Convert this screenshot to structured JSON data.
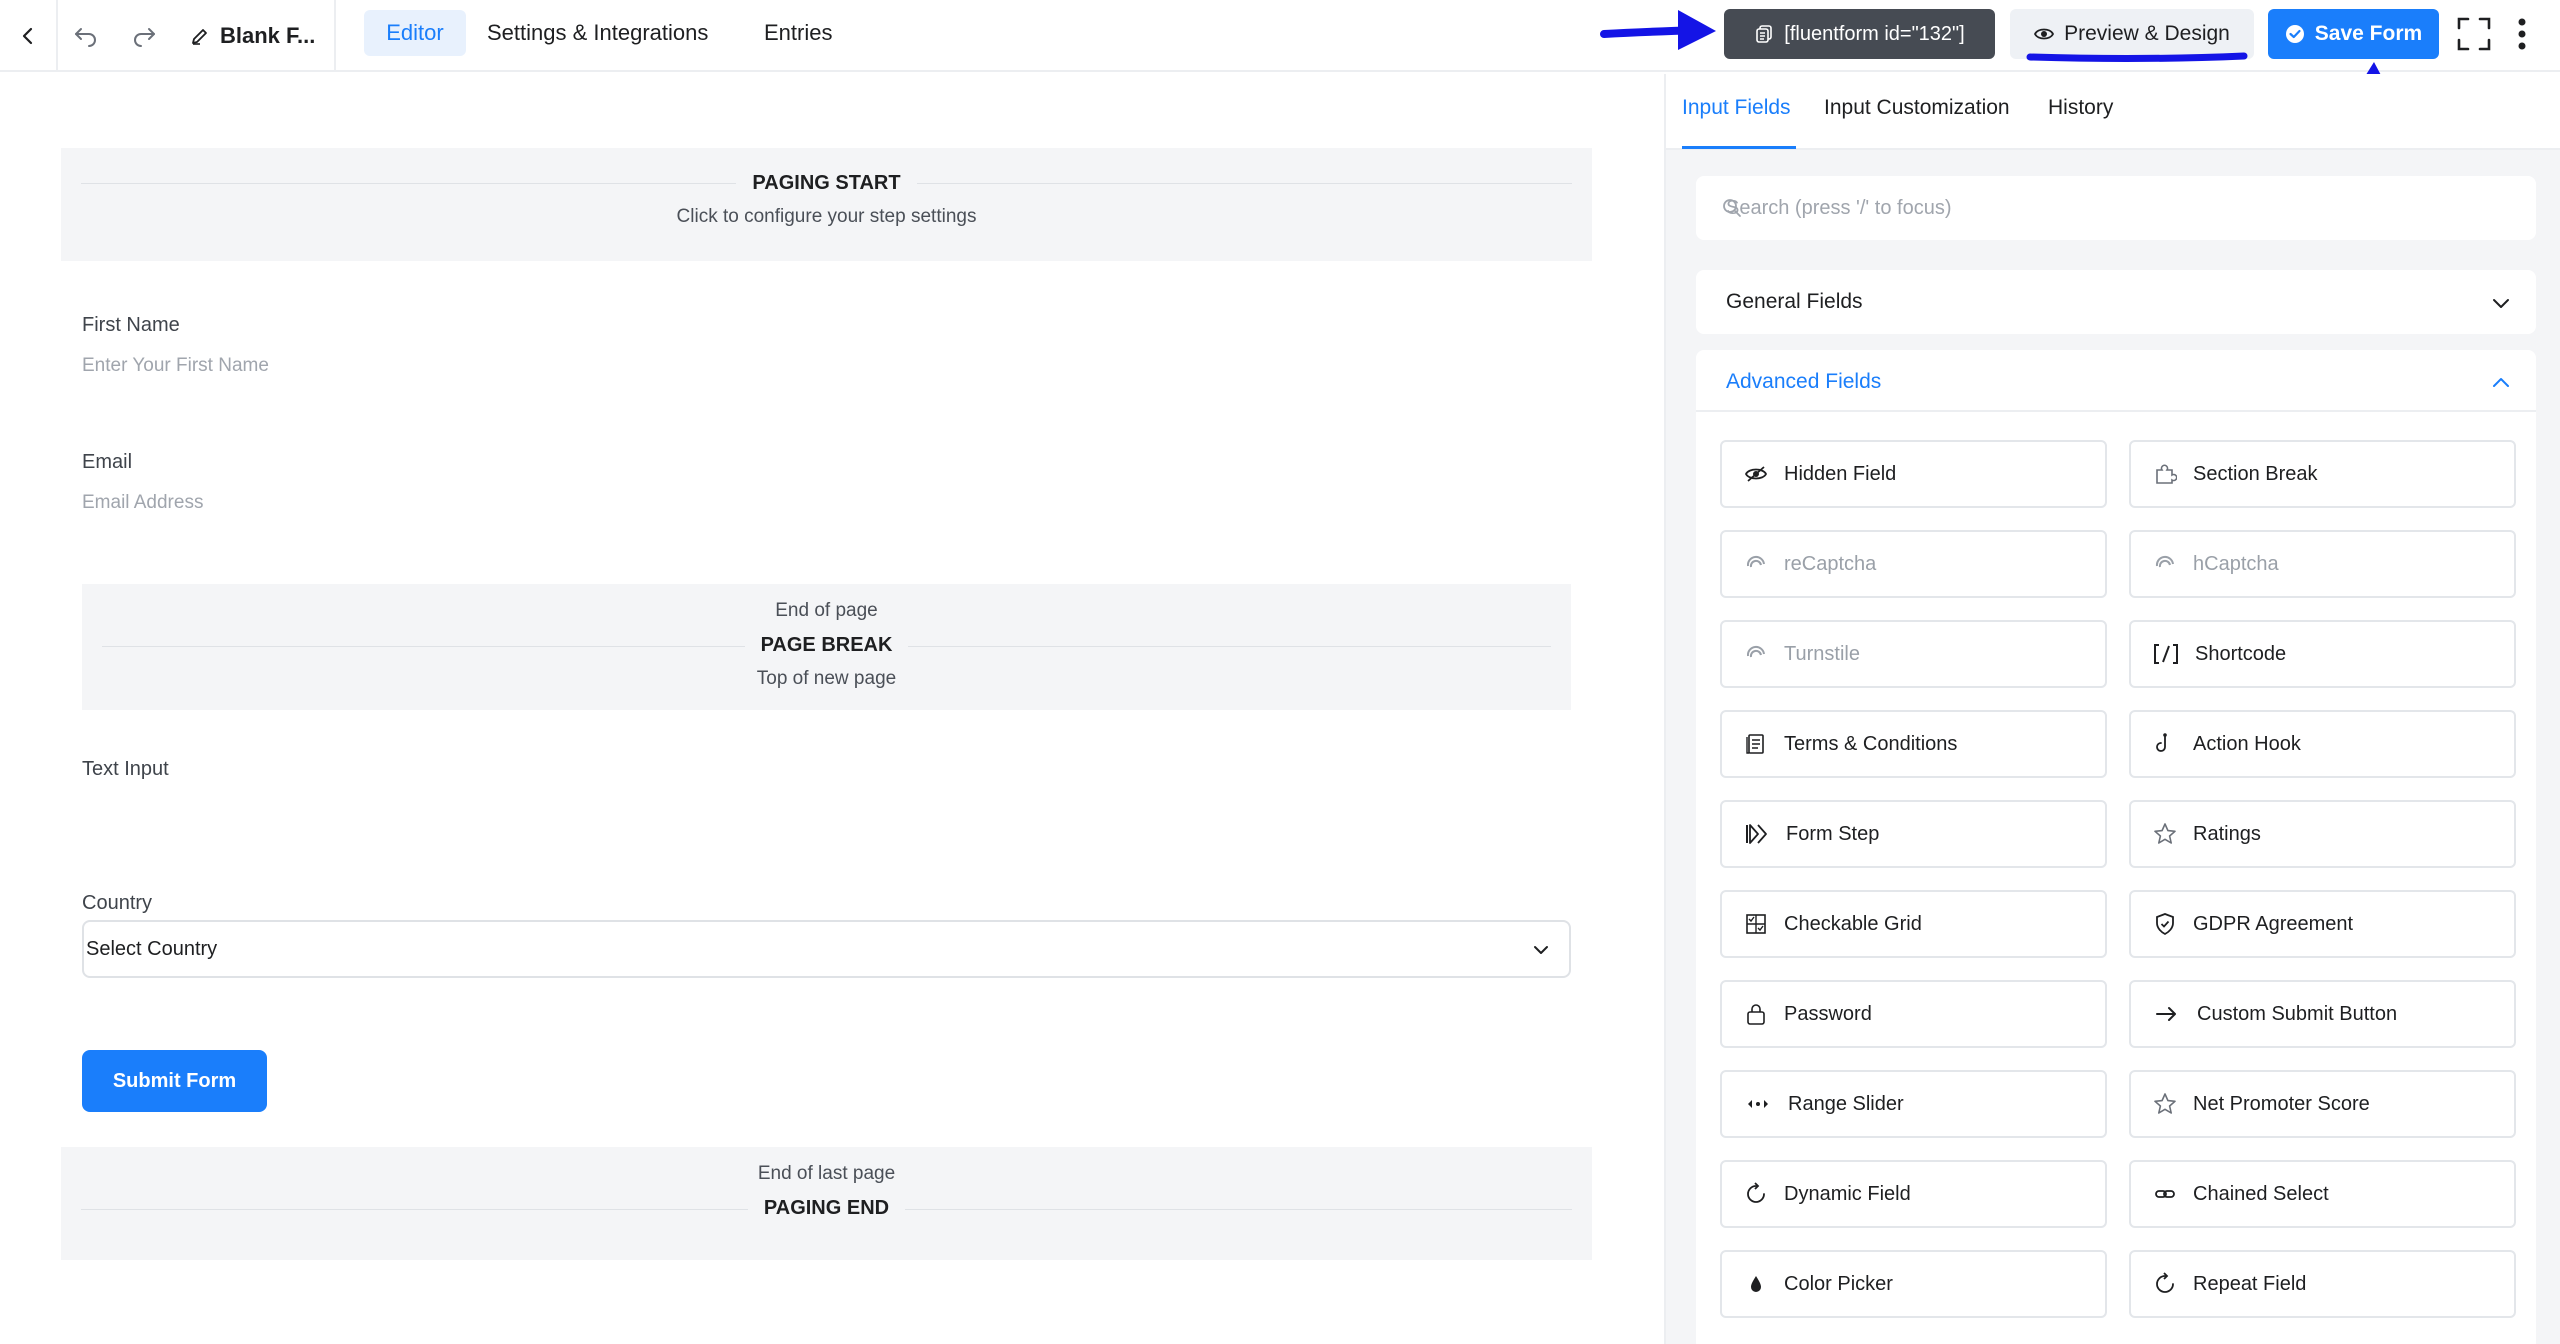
{
  "topbar": {
    "form_title": "Blank F...",
    "tabs": {
      "editor": "Editor",
      "settings": "Settings & Integrations",
      "entries": "Entries"
    },
    "shortcode": "[fluentform id=\"132\"]",
    "preview_label": "Preview & Design",
    "save_label": "Save Form"
  },
  "canvas": {
    "paging_start": {
      "title": "PAGING START",
      "subtitle": "Click to configure your step settings"
    },
    "first_name": {
      "label": "First Name",
      "placeholder": "Enter Your First Name"
    },
    "email": {
      "label": "Email",
      "placeholder": "Email Address"
    },
    "page_break": {
      "top": "End of page",
      "title": "PAGE BREAK",
      "bottom": "Top of new page"
    },
    "text_input": {
      "label": "Text Input"
    },
    "country": {
      "label": "Country",
      "value": "Select Country"
    },
    "submit": "Submit Form",
    "paging_end": {
      "top": "End of last page",
      "title": "PAGING END"
    }
  },
  "panel": {
    "tabs": {
      "input_fields": "Input Fields",
      "input_customization": "Input Customization",
      "history": "History"
    },
    "search_placeholder": "Search (press '/' to focus)",
    "general_fields": "General Fields",
    "advanced_fields": "Advanced Fields",
    "items": [
      {
        "label": "Hidden Field",
        "icon": "eye-slash-icon"
      },
      {
        "label": "Section Break",
        "icon": "puzzle-icon"
      },
      {
        "label": "reCaptcha",
        "icon": "captcha-icon"
      },
      {
        "label": "hCaptcha",
        "icon": "captcha-icon"
      },
      {
        "label": "Turnstile",
        "icon": "captcha-icon"
      },
      {
        "label": "Shortcode",
        "icon": "shortcode-icon"
      },
      {
        "label": "Terms & Conditions",
        "icon": "document-icon"
      },
      {
        "label": "Action Hook",
        "icon": "hook-icon"
      },
      {
        "label": "Form Step",
        "icon": "step-forward-icon"
      },
      {
        "label": "Ratings",
        "icon": "star-icon"
      },
      {
        "label": "Checkable Grid",
        "icon": "grid-check-icon"
      },
      {
        "label": "GDPR Agreement",
        "icon": "shield-icon"
      },
      {
        "label": "Password",
        "icon": "lock-icon"
      },
      {
        "label": "Custom Submit Button",
        "icon": "arrow-right-icon"
      },
      {
        "label": "Range Slider",
        "icon": "range-icon"
      },
      {
        "label": "Net Promoter Score",
        "icon": "star-icon"
      },
      {
        "label": "Dynamic Field",
        "icon": "refresh-icon"
      },
      {
        "label": "Chained Select",
        "icon": "link-icon"
      },
      {
        "label": "Color Picker",
        "icon": "drop-icon"
      },
      {
        "label": "Repeat Field",
        "icon": "refresh-icon"
      }
    ]
  },
  "colors": {
    "accent": "#1a7efb",
    "dark_button": "#464b53",
    "annotation": "#1414e6"
  }
}
